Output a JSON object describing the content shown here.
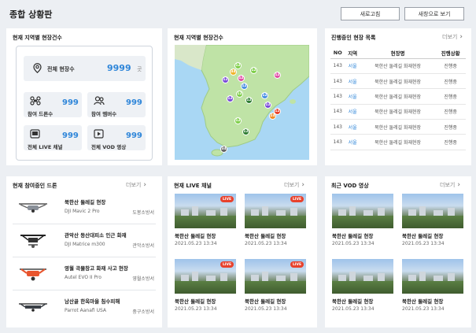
{
  "header": {
    "title": "종합 상황판",
    "refresh_label": "새로고침",
    "new_window_label": "새창으로 보기"
  },
  "site_count": {
    "title": "현재 지역별 현장건수",
    "total_label": "전체 현장수",
    "total_value": "9999",
    "total_unit": "곳",
    "drones_label": "참여 드론수",
    "drones_value": "999",
    "members_label": "참여 멤버수",
    "members_value": "999",
    "live_label": "전체 LIVE 채널",
    "live_value": "999",
    "vod_label": "전체 VOD 영상",
    "vod_value": "999"
  },
  "map": {
    "title": "현재 지역별 현장건수",
    "pins": [
      {
        "value": "12",
        "color": "#7fcf4a"
      },
      {
        "value": "34",
        "color": "#f0b429"
      },
      {
        "value": "12",
        "color": "#7a4bd8"
      },
      {
        "value": "12",
        "color": "#e04fa5"
      },
      {
        "value": "12",
        "color": "#4a90e2"
      },
      {
        "value": "12",
        "color": "#7fcf4a"
      },
      {
        "value": "12",
        "color": "#e04fa5"
      },
      {
        "value": "12",
        "color": "#7a4bd8"
      },
      {
        "value": "12",
        "color": "#7fcf4a"
      },
      {
        "value": "12",
        "color": "#2e7d32"
      },
      {
        "value": "12",
        "color": "#4a90e2"
      },
      {
        "value": "12",
        "color": "#7a4bd8"
      },
      {
        "value": "24",
        "color": "#f08a24"
      },
      {
        "value": "12",
        "color": "#e8412c"
      },
      {
        "value": "12",
        "color": "#7fcf4a"
      },
      {
        "value": "12",
        "color": "#2e7d32"
      },
      {
        "value": "34",
        "color": "#666666"
      }
    ]
  },
  "sites_table": {
    "title": "진행중인 현장 목록",
    "more_label": "더보기",
    "columns": [
      "NO",
      "지역",
      "현장명",
      "진행상황"
    ],
    "rows": [
      [
        "143",
        "서울",
        "북한산 둘레길 화재현장",
        "진행중"
      ],
      [
        "143",
        "서울",
        "북한산 둘레길 화재현장",
        "진행중"
      ],
      [
        "143",
        "서울",
        "북한산 둘레길 화재현장",
        "진행중"
      ],
      [
        "143",
        "서울",
        "북한산 둘레길 화재현장",
        "진행중"
      ],
      [
        "143",
        "서울",
        "북한산 둘레길 화재현장",
        "진행중"
      ],
      [
        "143",
        "서울",
        "북한산 둘레길 화재현장",
        "진행중"
      ]
    ]
  },
  "drones": {
    "title": "현재 참여중인 드론",
    "more_label": "더보기",
    "items": [
      {
        "name": "북한산 둘레길 현장",
        "model": "DJI Mavic 2 Pro",
        "station": "도봉소방서"
      },
      {
        "name": "관악산 등산대피소 인근 화재",
        "model": "DJI Matrice m300",
        "station": "관악소방서"
      },
      {
        "name": "영월 곡물창고 화재 사고 현장",
        "model": "Autel EVO II Pro",
        "station": "영월소방서"
      },
      {
        "name": "남산골 한옥마을 침수피해",
        "model": "Parrot Aanafi USA",
        "station": "중구소방서"
      }
    ]
  },
  "live": {
    "title": "현재 LIVE 채널",
    "more_label": "더보기",
    "badge": "LIVE",
    "items": [
      {
        "name": "북한산 둘레길 현장",
        "date": "2021.05.23 13:34"
      },
      {
        "name": "북한산 둘레길 현장",
        "date": "2021.05.23 13:34"
      },
      {
        "name": "북한산 둘레길 현장",
        "date": "2021.05.23 13:34"
      },
      {
        "name": "북한산 둘레길 현장",
        "date": "2021.05.23 13:34"
      }
    ]
  },
  "vod": {
    "title": "최근 VOD 영상",
    "more_label": "더보기",
    "items": [
      {
        "name": "북한산 둘레길 현장",
        "date": "2021.05.23 13:34"
      },
      {
        "name": "북한산 둘레길 현장",
        "date": "2021.05.23 13:34"
      },
      {
        "name": "북한산 둘레길 현장",
        "date": "2021.05.23 13:34"
      },
      {
        "name": "북한산 둘레길 현장",
        "date": "2021.05.23 13:34"
      }
    ]
  },
  "colors": {
    "accent": "#2f86d9",
    "live": "#e8412c",
    "background": "#eceff3"
  }
}
